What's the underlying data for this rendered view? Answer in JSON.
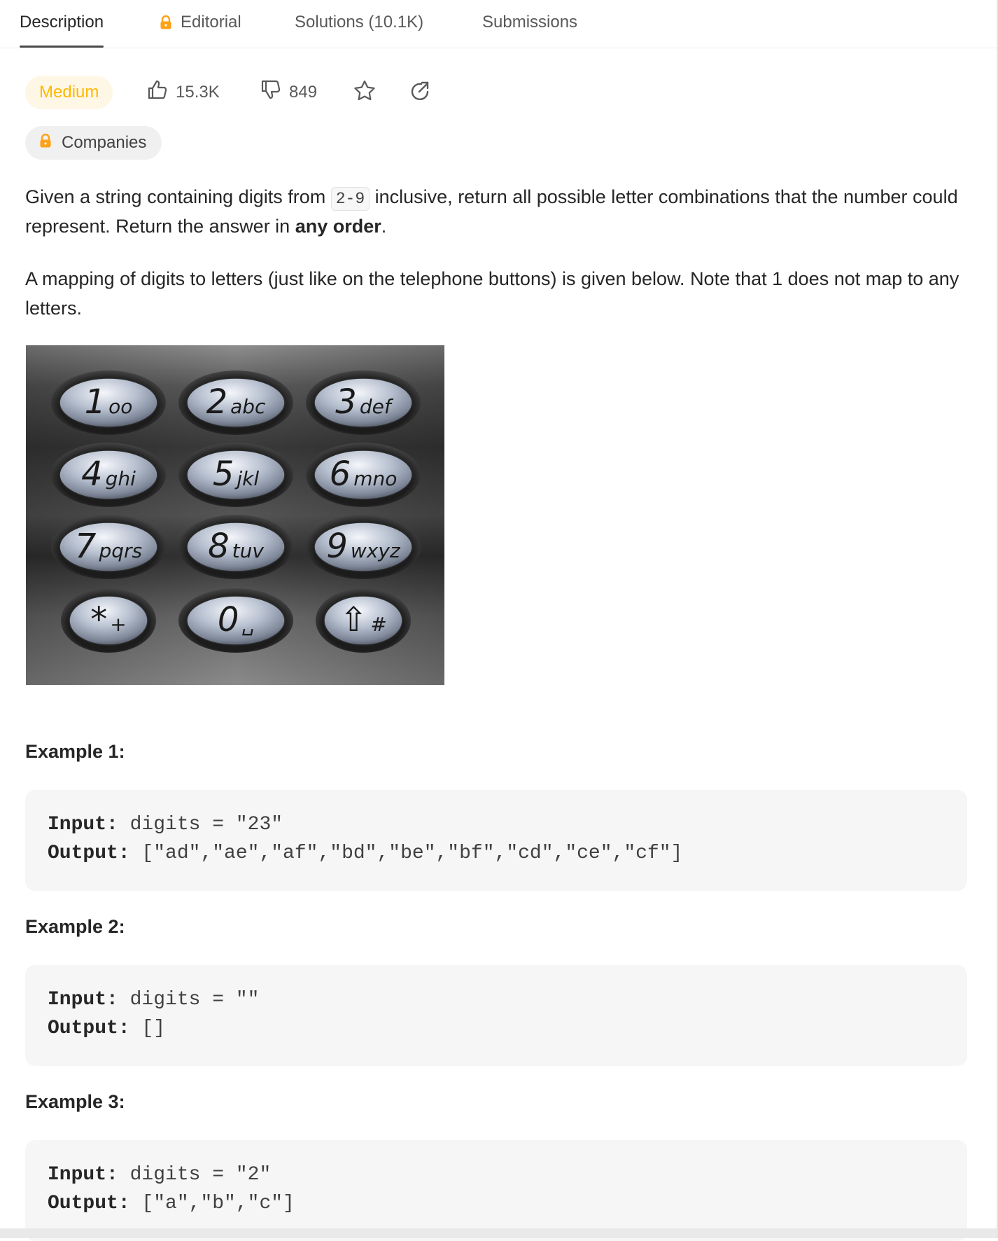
{
  "tabs": [
    {
      "label": "Description",
      "active": true
    },
    {
      "label": "Editorial",
      "locked": true
    },
    {
      "label": "Solutions (10.1K)"
    },
    {
      "label": "Submissions"
    }
  ],
  "meta": {
    "difficulty": "Medium",
    "likes": "15.3K",
    "dislikes": "849",
    "companies_label": "Companies",
    "icons": [
      "thumbs-up-icon",
      "thumbs-down-icon",
      "star-icon",
      "share-icon",
      "lock-icon"
    ]
  },
  "colors": {
    "difficulty_text": "#ffb800",
    "difficulty_bg": "#fff7e6",
    "lock": "#ffa116",
    "code_bg": "#f6f6f6"
  },
  "description": {
    "p1_before": "Given a string containing digits from ",
    "p1_code": "2-9",
    "p1_mid": " inclusive, return all possible letter combinations that the number could represent. Return the answer in ",
    "p1_bold": "any order",
    "p1_end": ".",
    "p2": "A mapping of digits to letters (just like on the telephone buttons) is given below. Note that 1 does not map to any letters."
  },
  "keypad": {
    "keys": [
      {
        "digit": "1",
        "letters": "oo"
      },
      {
        "digit": "2",
        "letters": "abc"
      },
      {
        "digit": "3",
        "letters": "def"
      },
      {
        "digit": "4",
        "letters": "ghi"
      },
      {
        "digit": "5",
        "letters": "jkl"
      },
      {
        "digit": "6",
        "letters": "mno"
      },
      {
        "digit": "7",
        "letters": "pqrs"
      },
      {
        "digit": "8",
        "letters": "tuv"
      },
      {
        "digit": "9",
        "letters": "wxyz"
      },
      {
        "digit": "*",
        "letters": "+"
      },
      {
        "digit": "0",
        "letters": "␣"
      },
      {
        "digit": "⇧",
        "letters": "#"
      }
    ]
  },
  "examples": [
    {
      "title": "Example 1:",
      "input_label": "Input:",
      "input": " digits = \"23\"",
      "output_label": "Output:",
      "output": " [\"ad\",\"ae\",\"af\",\"bd\",\"be\",\"bf\",\"cd\",\"ce\",\"cf\"]"
    },
    {
      "title": "Example 2:",
      "input_label": "Input:",
      "input": " digits = \"\"",
      "output_label": "Output:",
      "output": " []"
    },
    {
      "title": "Example 3:",
      "input_label": "Input:",
      "input": " digits = \"2\"",
      "output_label": "Output:",
      "output": " [\"a\",\"b\",\"c\"]"
    }
  ]
}
